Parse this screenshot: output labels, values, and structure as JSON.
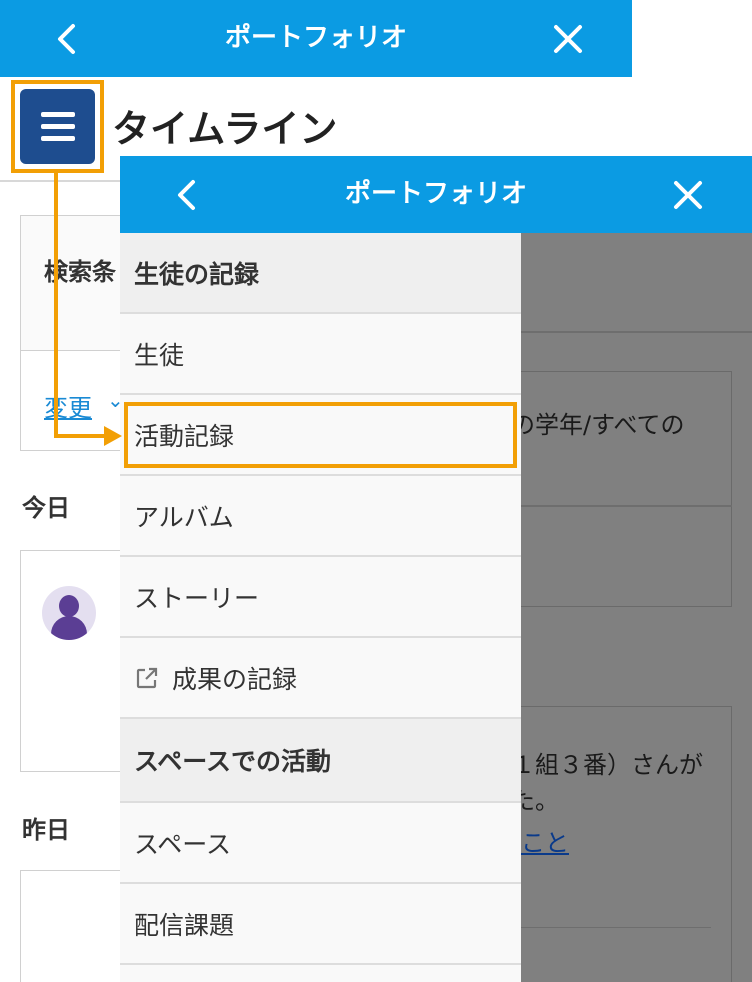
{
  "header": {
    "title": "ポートフォリオ",
    "back_icon": "chevron-left-icon",
    "close_icon": "close-icon"
  },
  "page": {
    "title": "タイムライン",
    "menu_icon": "hamburger-icon"
  },
  "search": {
    "label": "検索条",
    "change_link": "変更"
  },
  "days": {
    "today": "今日",
    "yesterday": "昨日"
  },
  "drawer": {
    "sections": [
      {
        "label": "生徒の記録"
      },
      {
        "label": "スペースでの活動"
      }
    ],
    "items": [
      {
        "label": "生徒"
      },
      {
        "label": "活動記録",
        "highlighted": true
      },
      {
        "label": "アルバム"
      },
      {
        "label": "ストーリー"
      },
      {
        "label": "成果の記録",
        "icon": "external-link-icon"
      },
      {
        "label": "スペース"
      },
      {
        "label": "配信課題"
      }
    ]
  },
  "background": {
    "filter_text": "の学年/すべての",
    "entry_text_1": "１組３番）さんが",
    "entry_text_2": "た。",
    "entry_link": "こと"
  },
  "colors": {
    "header_bg": "#0b9be3",
    "menu_button_bg": "#1e4d8f",
    "highlight": "#f29f05",
    "overlay_dim": "#808080"
  }
}
